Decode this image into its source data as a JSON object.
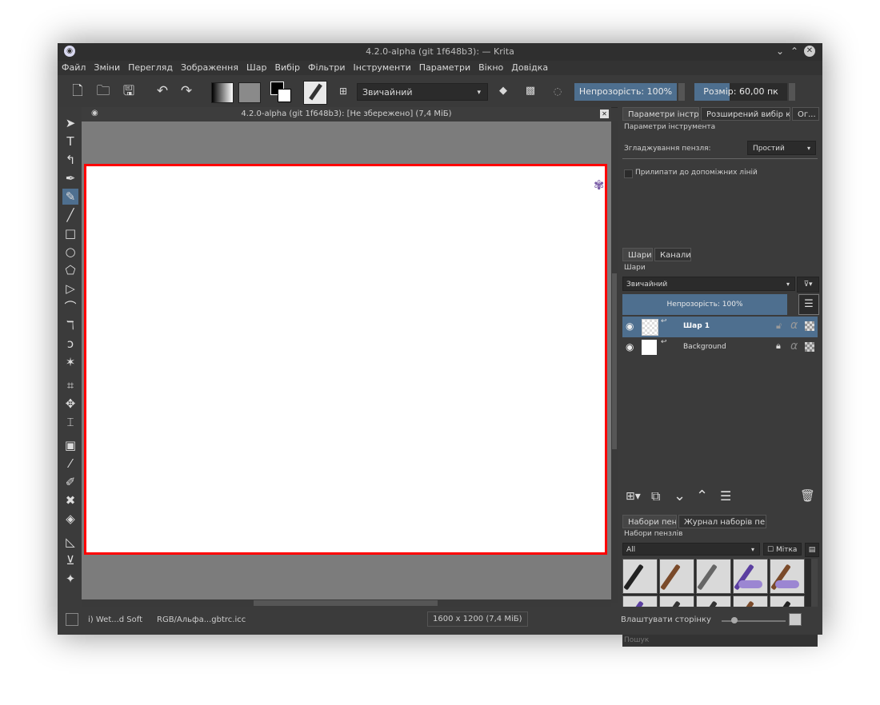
{
  "app": {
    "title": "4.2.0-alpha (git 1f648b3): — Krita",
    "document_title": "4.2.0-alpha (git 1f648b3):  [Не збережено]  (7,4 МіБ)"
  },
  "menu": [
    "Файл",
    "Зміни",
    "Перегляд",
    "Зображення",
    "Шар",
    "Вибір",
    "Фільтри",
    "Інструменти",
    "Параметри",
    "Вікно",
    "Довідка"
  ],
  "toolbar": {
    "blend_mode": "Звичайний",
    "opacity": "Непрозорість: 100%",
    "size": "Розмір: 60,00 пк"
  },
  "tool_options": {
    "tabs": [
      "Параметри інстру...",
      "Розширений вибір ко...",
      "Ог..."
    ],
    "header": "Параметри інструмента",
    "smoothing_label": "Згладжування пензля:",
    "smoothing_value": "Простий",
    "snap_label": "Прилипати до допоміжних ліній"
  },
  "layers": {
    "tabs": [
      "Шари",
      "Канали"
    ],
    "header": "Шари",
    "blend": "Звичайний",
    "opacity": "Непрозорість: 100%",
    "items": [
      {
        "name": "Шар 1",
        "selected": true
      },
      {
        "name": "Background",
        "selected": false
      }
    ]
  },
  "presets": {
    "tabs": [
      "Набори пензлів",
      "Журнал наборів пензлів"
    ],
    "header": "Набори пензлів",
    "filter": "All",
    "tag_label": "Мітка",
    "search_placeholder": "Пошук"
  },
  "status": {
    "brush": "i) Wet...d Soft",
    "color_profile": "RGB/Альфа...gbtrc.icc",
    "image_size": "1600 x 1200 (7,4 МіБ)",
    "fit_page": "Влаштувати сторінку"
  },
  "colors": {
    "accent": "#4e6f8f",
    "canvas_border": "#ff0000",
    "chrome": "#3b3b3b"
  }
}
